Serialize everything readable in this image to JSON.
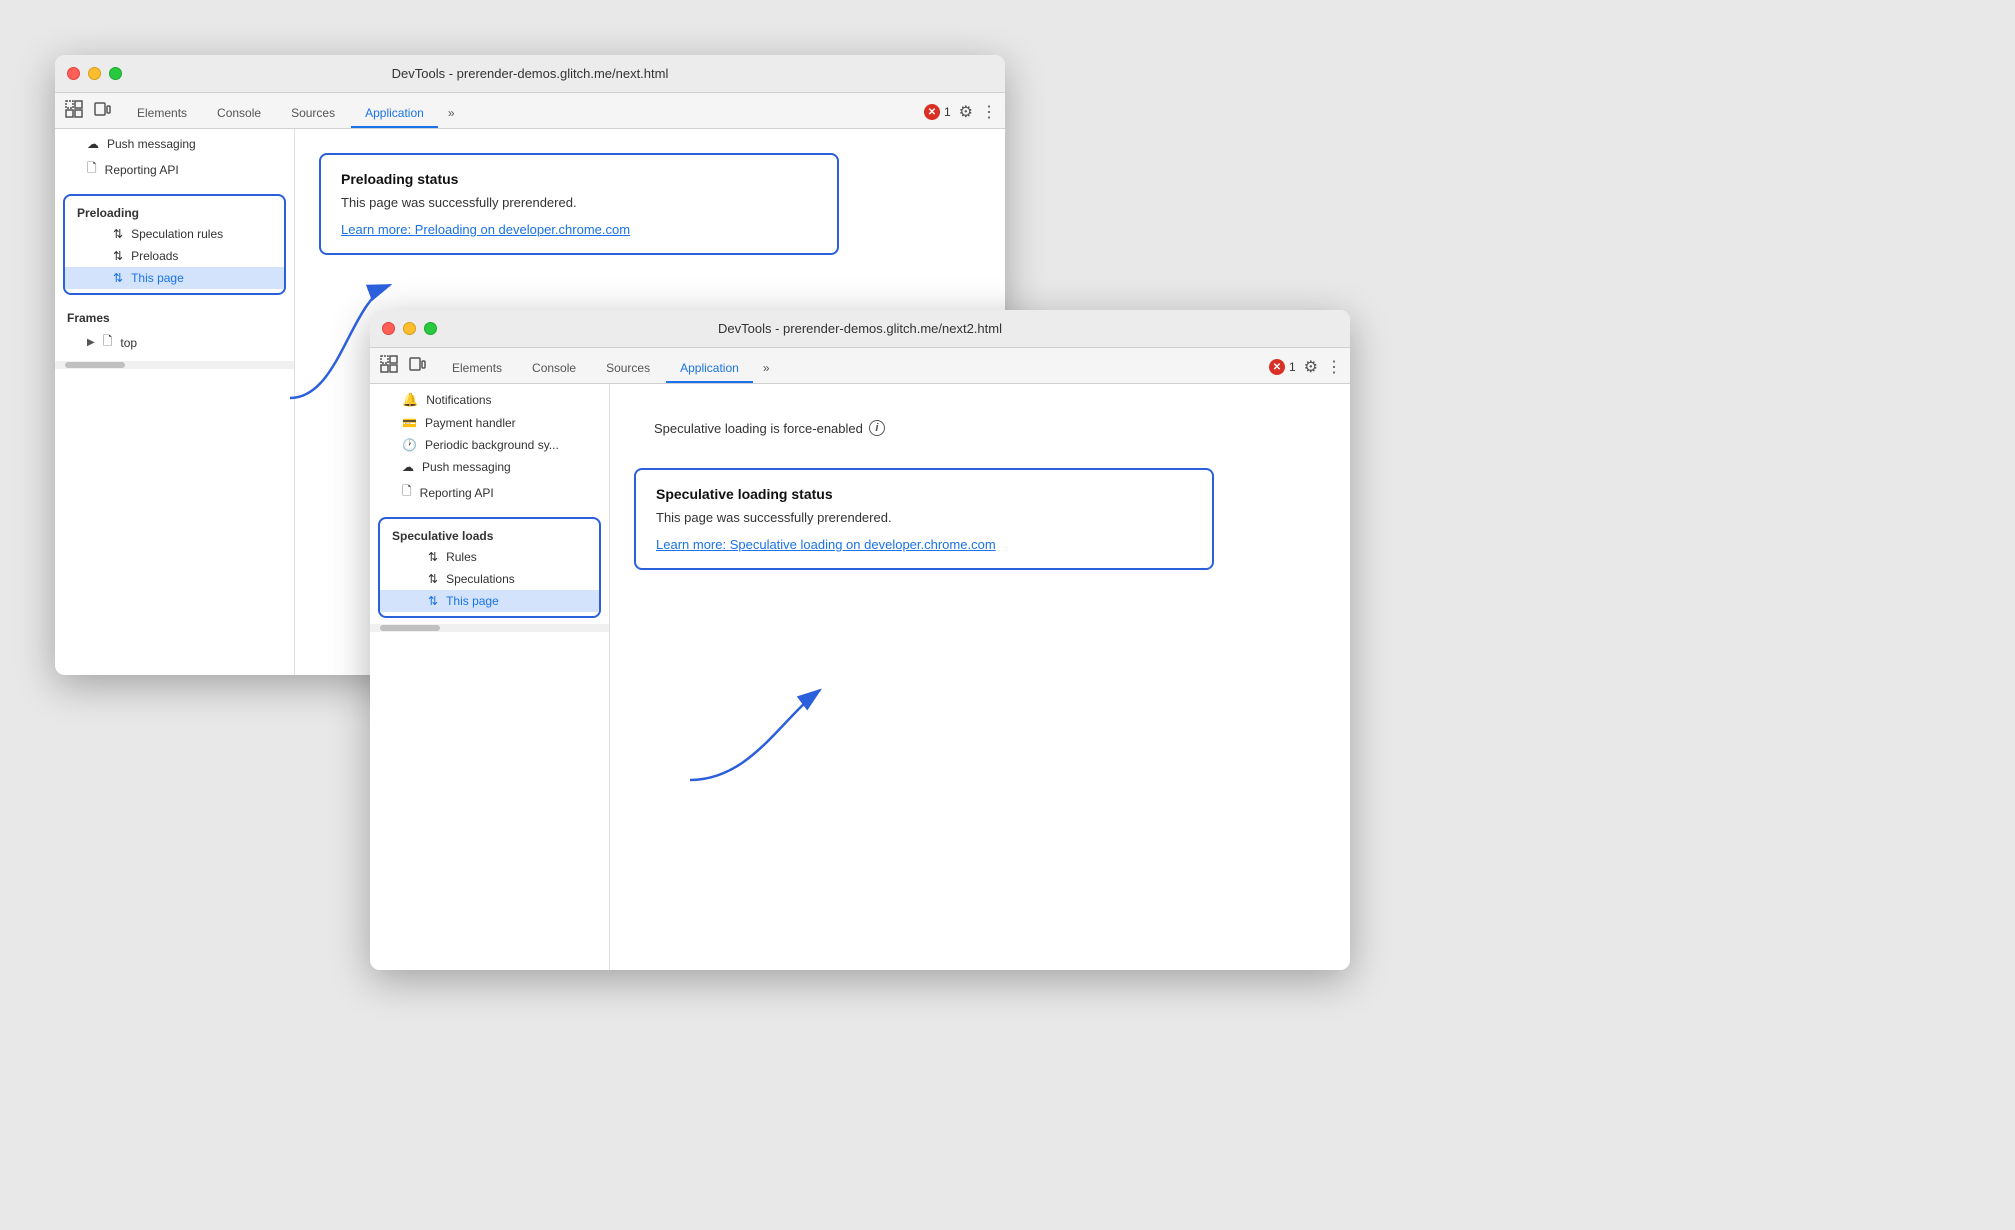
{
  "window1": {
    "title": "DevTools - prerender-demos.glitch.me/next.html",
    "tabs": [
      "Elements",
      "Console",
      "Sources",
      "Application"
    ],
    "active_tab": "Application",
    "error_count": "1",
    "sidebar": {
      "push_messaging": "Push messaging",
      "reporting_api": "Reporting API",
      "preloading_header": "Preloading",
      "speculation_rules": "Speculation rules",
      "preloads": "Preloads",
      "this_page": "This page",
      "frames_header": "Frames",
      "top": "top"
    },
    "main": {
      "status_title": "Preloading status",
      "status_text": "This page was successfully prerendered.",
      "learn_more_link": "Learn more: Preloading on developer.chrome.com"
    }
  },
  "window2": {
    "title": "DevTools - prerender-demos.glitch.me/next2.html",
    "tabs": [
      "Elements",
      "Console",
      "Sources",
      "Application"
    ],
    "active_tab": "Application",
    "error_count": "1",
    "sidebar": {
      "notifications": "Notifications",
      "payment_handler": "Payment handler",
      "periodic_background": "Periodic background sy...",
      "push_messaging": "Push messaging",
      "reporting_api": "Reporting API",
      "speculative_loads_header": "Speculative loads",
      "rules": "Rules",
      "speculations": "Speculations",
      "this_page": "This page"
    },
    "main": {
      "force_enabled": "Speculative loading is force-enabled",
      "status_title": "Speculative loading status",
      "status_text": "This page was successfully prerendered.",
      "learn_more_link": "Learn more: Speculative loading on developer.chrome.com"
    }
  },
  "icons": {
    "updown_arrow": "⇅",
    "tree_arrow": "▶",
    "folder": "🗋",
    "cloud": "☁",
    "doc": "🗋",
    "payment": "💳",
    "clock": "🕐",
    "info": "i",
    "gear": "⚙",
    "menu": "⋮",
    "more": "»",
    "inspect": "⬚",
    "device": "⬚"
  }
}
